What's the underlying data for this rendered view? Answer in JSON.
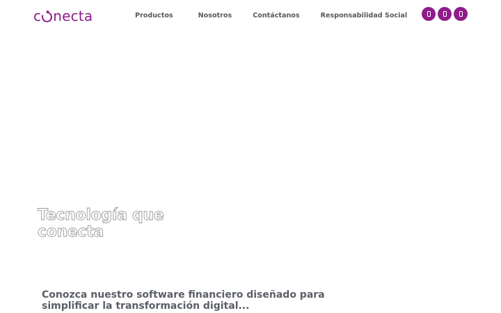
{
  "theme": {
    "brand": "#8e1d8a",
    "nav_text": "#555a5f",
    "subtitle_text": "#5a5f66"
  },
  "header": {
    "logo_text": {
      "c": "c",
      "rest": "necta"
    },
    "nav": [
      {
        "label": "Productos"
      },
      {
        "label": "Nosotros"
      },
      {
        "label": "Contáctanos"
      },
      {
        "label": "Responsabilidad Social"
      }
    ],
    "socials": [
      {
        "icon": "facebook-icon"
      },
      {
        "icon": "instagram-icon"
      },
      {
        "icon": "linkedin-icon"
      }
    ]
  },
  "hero": {
    "title_line1": "Tecnología que",
    "title_line2": "conecta",
    "subtitle_line1": "Conozca nuestro software financiero diseñado para",
    "subtitle_line2": "simplificar la transformación digital..."
  }
}
